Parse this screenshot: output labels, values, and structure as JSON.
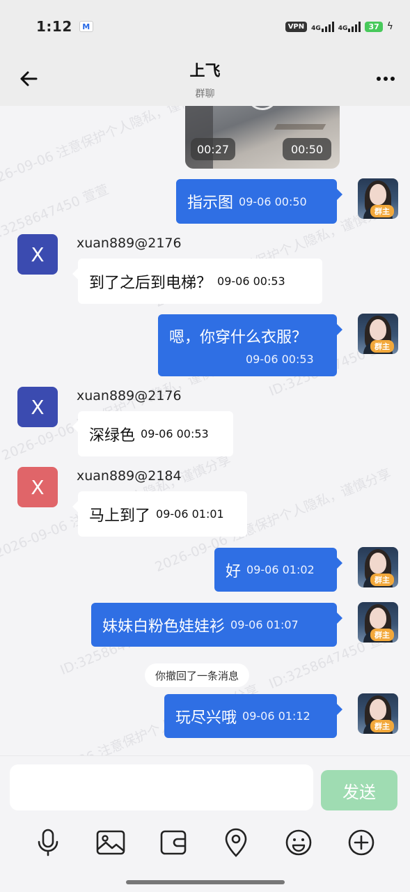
{
  "status_bar": {
    "time": "1:12",
    "mail_icon": "M",
    "vpn": "VPN",
    "net1": "4G",
    "net2": "4G",
    "battery": "37"
  },
  "header": {
    "title": "上飞",
    "subtitle": "群聊"
  },
  "video": {
    "duration": "00:27",
    "time": "00:50"
  },
  "owner_badge": "群主",
  "messages": [
    {
      "dir": "out",
      "text": "指示图",
      "time": "09-06 00:50"
    },
    {
      "dir": "in",
      "sender": "xuan889@2176",
      "avatar": "X",
      "avatar_color": "#3b4bb0",
      "text": "到了之后到电梯？",
      "time": "09-06 00:53"
    },
    {
      "dir": "out",
      "text": "嗯，你穿什么衣服？",
      "time": "09-06 00:53"
    },
    {
      "dir": "in",
      "sender": "xuan889@2176",
      "avatar": "X",
      "avatar_color": "#3b4bb0",
      "text": "深绿色",
      "time": "09-06 00:53"
    },
    {
      "dir": "in",
      "sender": "xuan889@2184",
      "avatar": "X",
      "avatar_color": "#e06569",
      "text": "马上到了",
      "time": "09-06 01:01"
    },
    {
      "dir": "out",
      "text": "好",
      "time": "09-06 01:02"
    },
    {
      "dir": "out",
      "text": "妹妹白粉色娃娃衫",
      "time": "09-06 01:07"
    },
    {
      "dir": "out",
      "text": "玩尽兴哦",
      "time": "09-06 01:12"
    }
  ],
  "system_note": "你撤回了一条消息",
  "watermarks": {
    "w1": "ID:3258647450 萱萱",
    "w2": "2026-09-06 注意保护个人隐私，谨慎分享"
  },
  "input": {
    "placeholder": "",
    "send_label": "发送"
  },
  "toolbar_icons": [
    "microphone-icon",
    "image-icon",
    "wallet-icon",
    "location-icon",
    "emoji-icon",
    "plus-icon"
  ],
  "colors": {
    "outgoing_bubble": "#2f6fe4",
    "send_button": "#9fdcb2",
    "owner_badge": "#f2a83b"
  }
}
